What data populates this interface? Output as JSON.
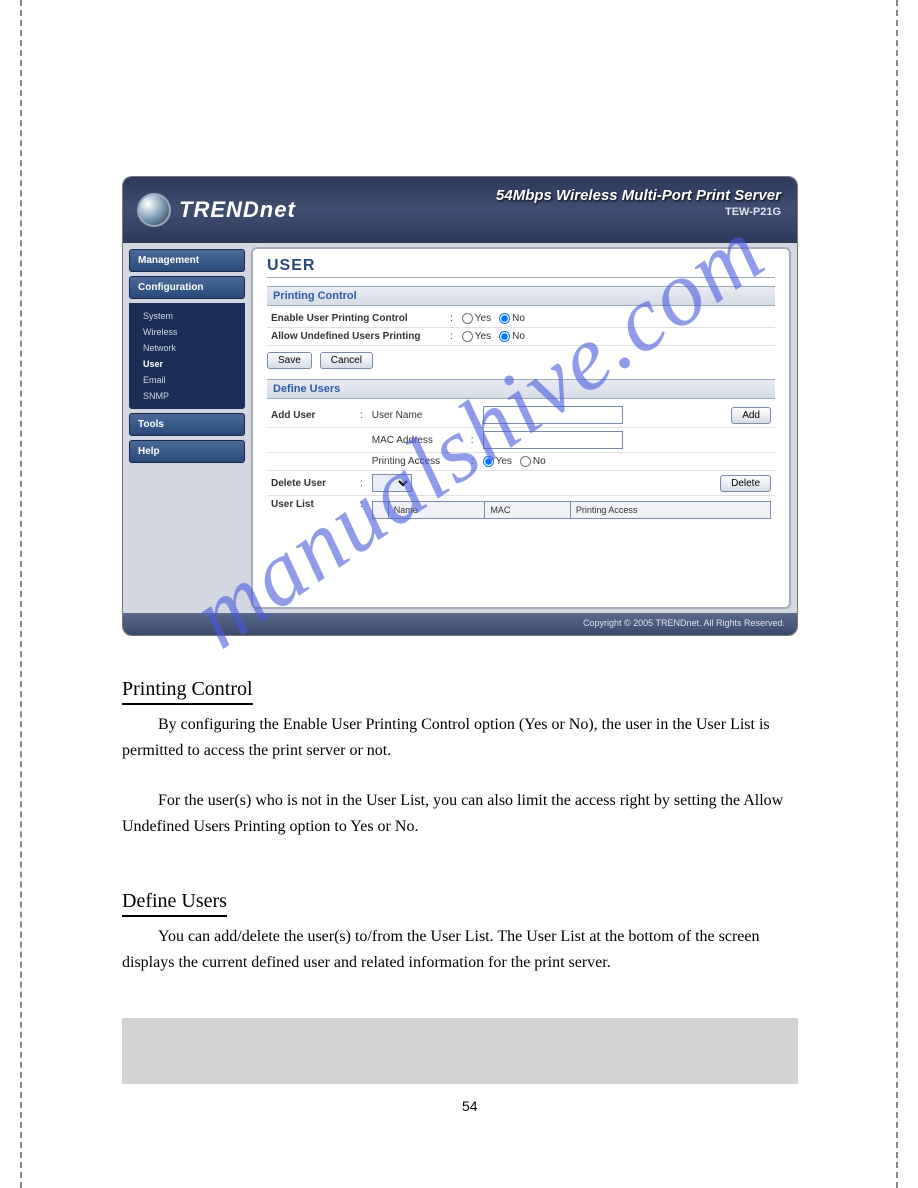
{
  "brand": {
    "name": "TRENDnet"
  },
  "header": {
    "title": "54Mbps Wireless Multi-Port Print Server",
    "model": "TEW-P21G"
  },
  "nav": {
    "management": "Management",
    "configuration": "Configuration",
    "items": {
      "system": "System",
      "wireless": "Wireless",
      "network": "Network",
      "user": "User",
      "email": "Email",
      "snmp": "SNMP"
    },
    "tools": "Tools",
    "help": "Help"
  },
  "page": {
    "title": "USER",
    "printing_section": "Printing Control",
    "enable_label": "Enable User Printing Control",
    "allow_label": "Allow Undefined Users Printing",
    "yes": "Yes",
    "no": "No",
    "save": "Save",
    "cancel": "Cancel",
    "define_section": "Define Users",
    "add_user": "Add User",
    "user_name": "User Name",
    "mac_address": "MAC Address",
    "printing_access": "Printing Access",
    "add_btn": "Add",
    "delete_user": "Delete User",
    "delete_btn": "Delete",
    "user_list": "User List",
    "col_name": "Name",
    "col_mac": "MAC",
    "col_pa": "Printing Access"
  },
  "footer": "Copyright © 2005 TRENDnet. All Rights Reserved.",
  "doc": {
    "h1": "Printing Control",
    "p1": "By configuring the Enable User Printing Control option (Yes or No), the user in the User List is permitted to access the print server or not.",
    "p2": "For the user(s) who is not in the User List, you can also limit the access right by setting the Allow Undefined Users Printing option to Yes or No.",
    "h2": "Define Users",
    "p3": "You can add/delete the user(s) to/from the User List. The User List at the bottom of the screen displays the current defined user and related information for the print server.",
    "pagenum": "54"
  },
  "watermark": "manualshive.com"
}
